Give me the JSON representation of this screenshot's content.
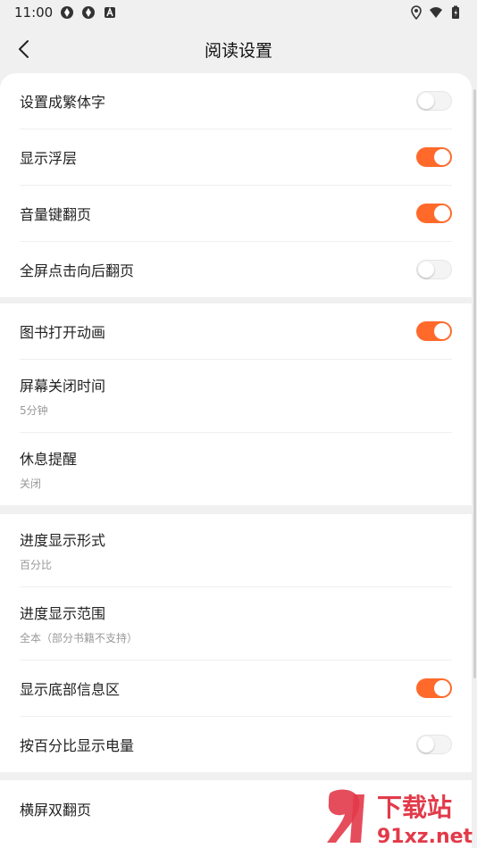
{
  "status_bar": {
    "time": "11:00"
  },
  "header": {
    "title": "阅读设置"
  },
  "sections": [
    {
      "rows": [
        {
          "label": "设置成繁体字",
          "toggle": false
        },
        {
          "label": "显示浮层",
          "toggle": true
        },
        {
          "label": "音量键翻页",
          "toggle": true
        },
        {
          "label": "全屏点击向后翻页",
          "toggle": false
        }
      ]
    },
    {
      "rows": [
        {
          "label": "图书打开动画",
          "toggle": true
        },
        {
          "label": "屏幕关闭时间",
          "value": "5分钟"
        },
        {
          "label": "休息提醒",
          "value": "关闭"
        }
      ]
    },
    {
      "rows": [
        {
          "label": "进度显示形式",
          "value": "百分比"
        },
        {
          "label": "进度显示范围",
          "value": "全本（部分书籍不支持）"
        },
        {
          "label": "显示底部信息区",
          "toggle": true
        },
        {
          "label": "按百分比显示电量",
          "toggle": false
        }
      ]
    },
    {
      "rows": [
        {
          "label": "横屏双翻页"
        }
      ]
    }
  ],
  "watermark": {
    "text": "下载站",
    "url": "91xz.net"
  },
  "colors": {
    "accent": "#ff6a2b",
    "background": "#f0f0f0"
  }
}
